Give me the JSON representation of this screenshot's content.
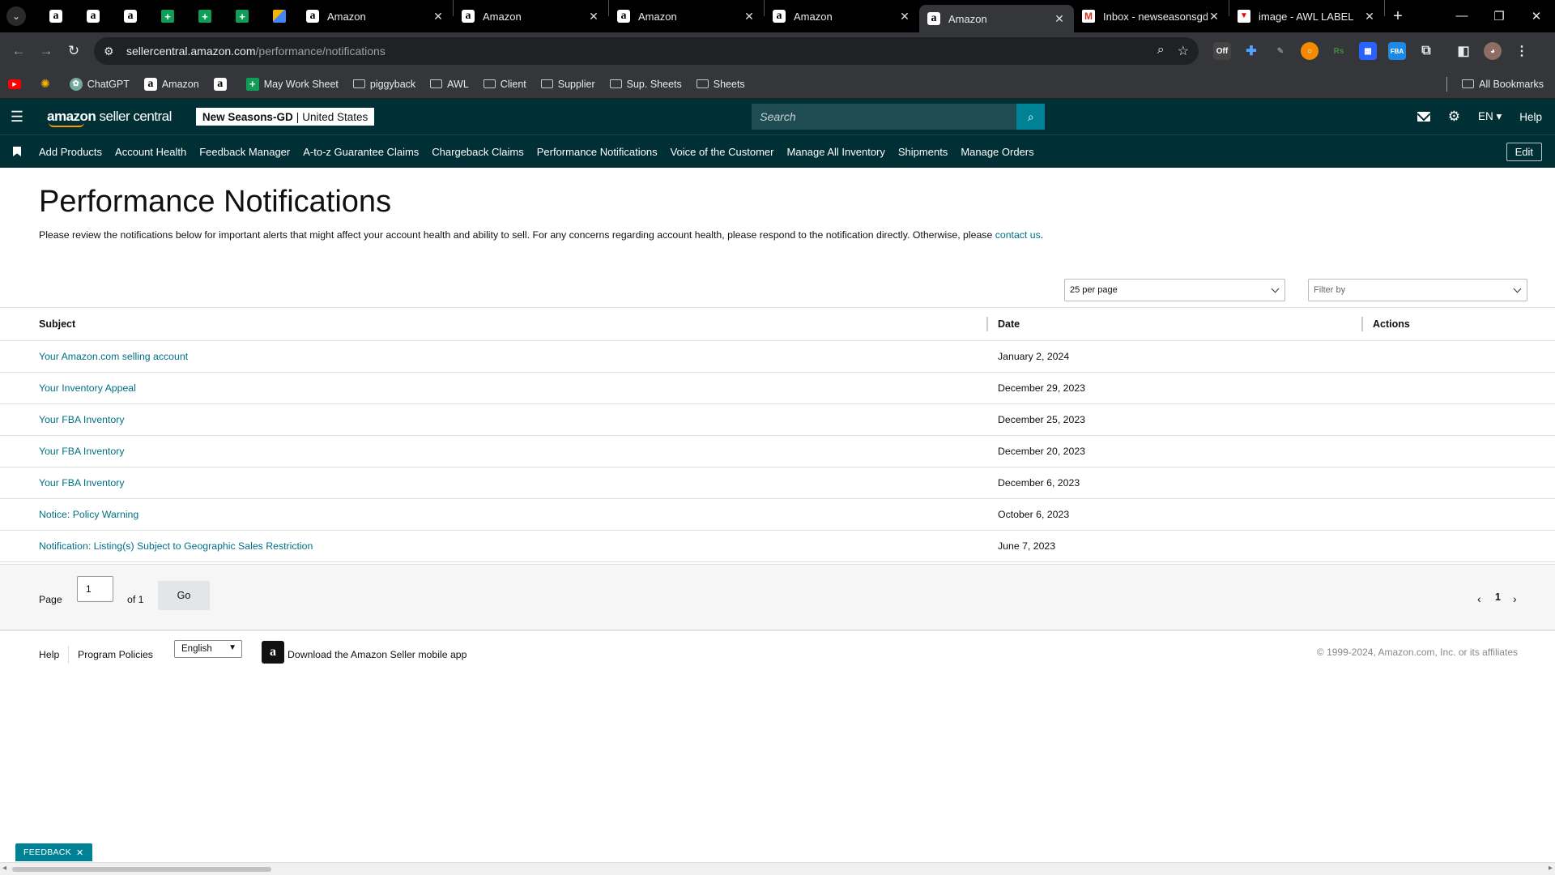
{
  "browser": {
    "pinned_tabs": [
      {
        "icon": "amazon-icon",
        "glyph": "a"
      },
      {
        "icon": "amazon-icon",
        "glyph": "a"
      },
      {
        "icon": "amazon-icon",
        "glyph": "a"
      },
      {
        "icon": "sheets-icon",
        "glyph": "+"
      },
      {
        "icon": "sheets-icon",
        "glyph": "+"
      },
      {
        "icon": "sheets-icon",
        "glyph": "+"
      },
      {
        "icon": "pen-icon",
        "glyph": ""
      }
    ],
    "tabs": [
      {
        "title": "Amazon",
        "icon": "amazon-icon",
        "glyph": "a",
        "active": false
      },
      {
        "title": "Amazon",
        "icon": "amazon-icon",
        "glyph": "a",
        "active": false
      },
      {
        "title": "Amazon",
        "icon": "amazon-icon",
        "glyph": "a",
        "active": false
      },
      {
        "title": "Amazon",
        "icon": "amazon-icon",
        "glyph": "a",
        "active": false
      },
      {
        "title": "Amazon",
        "icon": "amazon-icon",
        "glyph": "a",
        "active": true
      },
      {
        "title": "Inbox - newseasonsgd",
        "icon": "gmail-icon",
        "glyph": "M",
        "active": false
      },
      {
        "title": "image - AWL LABEL",
        "icon": "awl-icon",
        "glyph": "▼",
        "active": false
      }
    ],
    "close_glyph": "✕",
    "new_tab_glyph": "+",
    "url_host": "sellercentral.amazon.com",
    "url_path": "/performance/notifications",
    "bookmarks": [
      {
        "label": "",
        "icon": "youtube-icon"
      },
      {
        "label": "",
        "icon": "sun-icon"
      },
      {
        "label": "ChatGPT",
        "icon": "chatgpt-icon"
      },
      {
        "label": "Amazon",
        "icon": "amazon-icon"
      },
      {
        "label": "",
        "icon": "amazon-icon"
      },
      {
        "label": "May Work Sheet",
        "icon": "sheets-icon"
      },
      {
        "label": "piggyback",
        "icon": "folder-icon"
      },
      {
        "label": "AWL",
        "icon": "folder-icon"
      },
      {
        "label": "Client",
        "icon": "folder-icon"
      },
      {
        "label": "Supplier",
        "icon": "folder-icon"
      },
      {
        "label": "Sup. Sheets",
        "icon": "folder-icon"
      },
      {
        "label": "Sheets",
        "icon": "folder-icon"
      }
    ],
    "all_bookmarks": "All Bookmarks"
  },
  "header": {
    "logo_bold": "amazon",
    "logo_rest": " seller central",
    "store_name": "New Seasons-GD",
    "store_region": "United States",
    "search_placeholder": "Search",
    "language": "EN",
    "help": "Help"
  },
  "nav": {
    "links": [
      "Add Products",
      "Account Health",
      "Feedback Manager",
      "A-to-z Guarantee Claims",
      "Chargeback Claims",
      "Performance Notifications",
      "Voice of the Customer",
      "Manage All Inventory",
      "Shipments",
      "Manage Orders"
    ],
    "edit": "Edit"
  },
  "page": {
    "title": "Performance Notifications",
    "intro": "Please review the notifications below for important alerts that might affect your account health and ability to sell. For any concerns regarding account health, please respond to the notification directly. Otherwise, please ",
    "contact_link": "contact us",
    "intro_end": ".",
    "per_page": "25 per page",
    "filter_placeholder": "Filter by"
  },
  "table": {
    "headers": {
      "subject": "Subject",
      "date": "Date",
      "actions": "Actions"
    },
    "rows": [
      {
        "subject": "Your Amazon.com selling account",
        "date": "January 2, 2024"
      },
      {
        "subject": "Your Inventory Appeal",
        "date": "December 29, 2023"
      },
      {
        "subject": "Your FBA Inventory",
        "date": "December 25, 2023"
      },
      {
        "subject": "Your FBA Inventory",
        "date": "December 20, 2023"
      },
      {
        "subject": "Your FBA Inventory",
        "date": "December 6, 2023"
      },
      {
        "subject": "Notice: Policy Warning",
        "date": "October 6, 2023"
      },
      {
        "subject": "Notification: Listing(s) Subject to Geographic Sales Restriction",
        "date": "June 7, 2023"
      }
    ]
  },
  "pager": {
    "page_label": "Page",
    "page_value": "1",
    "of_label": "of 1",
    "go": "Go",
    "current": "1"
  },
  "footer": {
    "help": "Help",
    "policies": "Program Policies",
    "language": "English",
    "app_text": "Download the Amazon Seller mobile app",
    "copyright": "© 1999-2024, Amazon.com, Inc. or its affiliates"
  },
  "feedback": "FEEDBACK",
  "colors": {
    "header_bg": "#002f36",
    "link": "#007185",
    "accent": "#008296",
    "brand_orange": "#ff9900"
  }
}
